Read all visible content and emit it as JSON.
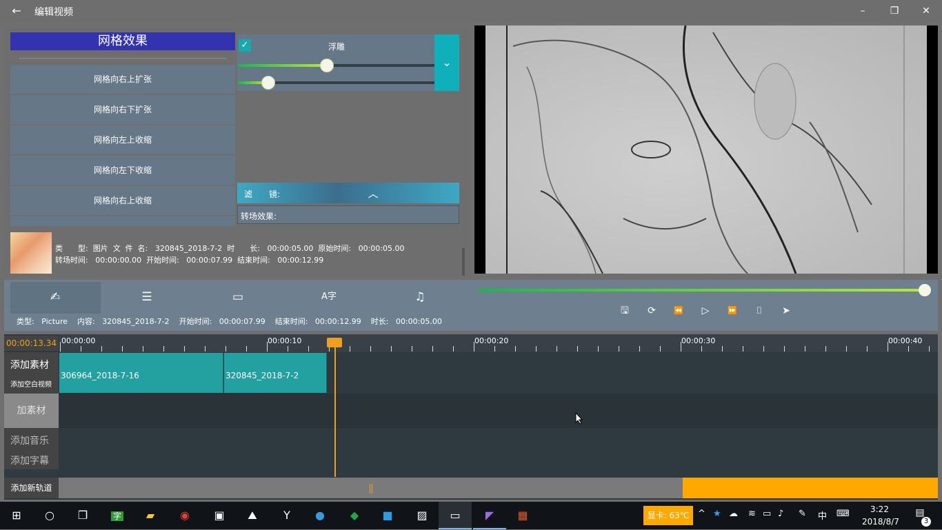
{
  "window": {
    "back_icon": "back-arrow-icon",
    "title": "编辑视频",
    "minimize": "–",
    "restore": "❐",
    "close": "✕"
  },
  "effects": {
    "title": "网格效果",
    "items": [
      "网格向右上扩张",
      "网格向右下扩张",
      "网格向左上收缩",
      "网格向左下收缩",
      "网格向右上收缩"
    ]
  },
  "emboss": {
    "checked": true,
    "label": "浮雕",
    "slider1": 0.45,
    "slider2": 0.15,
    "toggle_icon": "chevron-down-icon"
  },
  "filter": {
    "label": "滤　　镜:",
    "toggle_icon": "chevron-up-icon"
  },
  "transition": {
    "label": "转场效果:"
  },
  "info": {
    "line1": "类　　型:  图片  文  件  名:   320845_2018-7-2  时　　长:   00:00:05.00  原始时间:   00:00:05.00",
    "line2": "转场时间:   00:00:00.00  开始时间:   00:00:07.99  结束时间:   00:00:12.99"
  },
  "toolbar": {
    "tabs": [
      {
        "icon": "signature-icon",
        "glyph": "✍"
      },
      {
        "icon": "list-icon",
        "glyph": "☰"
      },
      {
        "icon": "video-camera-icon",
        "glyph": "▭"
      },
      {
        "icon": "text-font-icon",
        "glyph": "A字"
      },
      {
        "icon": "music-icon",
        "glyph": "♫"
      }
    ],
    "clip_info": "类型:   Picture    内容:   320845_2018-7-2    开始时间:   00:00:07.99    结束时间:   00:00:12.99    时长:   00:00:05.00"
  },
  "player": {
    "progress": 0.98,
    "buttons": [
      {
        "name": "save-icon",
        "glyph": "🖫"
      },
      {
        "name": "replay-icon",
        "glyph": "⟳"
      },
      {
        "name": "rewind-icon",
        "glyph": "⏪"
      },
      {
        "name": "play-icon",
        "glyph": "▷"
      },
      {
        "name": "fast-forward-icon",
        "glyph": "⏩"
      },
      {
        "name": "camera-icon",
        "glyph": "⌷"
      },
      {
        "name": "send-icon",
        "glyph": "➤"
      }
    ]
  },
  "timeline": {
    "current_time": "00:00:13.34",
    "ruler_labels": [
      "00:00:00",
      "00:00:10",
      "00:00:20",
      "00:00:30",
      "00:00:40"
    ],
    "clips": [
      "306964_2018-7-16",
      "320845_2018-7-2"
    ],
    "track1_label": "添加素材",
    "track1_sub": "添加空白视频",
    "track2_label": "加素材",
    "track3_label1": "添加音乐",
    "track3_label2": "添加字幕",
    "add_track": "添加新轨道"
  },
  "taskbar": {
    "apps": [
      "start-icon",
      "cortana-icon",
      "task-view-icon",
      "translate-app-icon",
      "file-explorer-icon",
      "chrome-icon",
      "photo-viewer-icon",
      "photos-icon",
      "yahoo-icon",
      "app-icon",
      "green-app-icon",
      "bird-app-icon",
      "capcut-icon",
      "terminal-icon",
      "visual-studio-icon",
      "store-icon"
    ],
    "gpu": "显卡: 63℃",
    "ime": "中",
    "time": "3:22",
    "date": "2018/8/7",
    "notifications": "3"
  }
}
